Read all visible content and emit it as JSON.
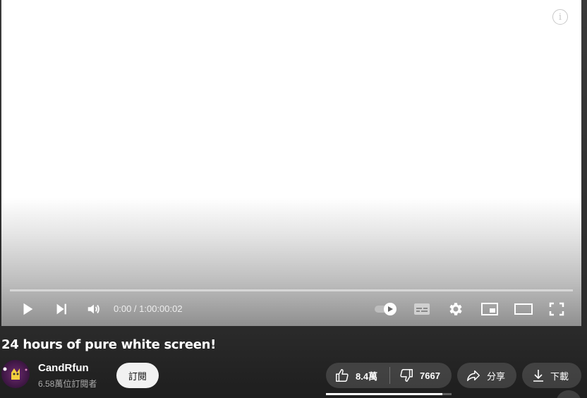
{
  "player": {
    "current_time": "0:00",
    "duration": "1:00:00:02",
    "time_display": "0:00 / 1:00:00:02",
    "progress": 0,
    "info_icon": "i"
  },
  "video": {
    "title": "24 hours of pure white screen!"
  },
  "channel": {
    "name": "CandRfun",
    "subscribers": "6.58萬位訂閱者",
    "subscribe_label": "訂閱"
  },
  "actions": {
    "like_count": "8.4萬",
    "dislike_count": "7667",
    "share_label": "分享",
    "download_label": "下載"
  },
  "icons": {
    "play": "play-icon",
    "next": "next-icon",
    "volume": "volume-icon",
    "autoplay": "autoplay-toggle-icon",
    "subtitles": "subtitles-icon",
    "settings": "gear-icon",
    "miniplayer": "miniplayer-icon",
    "theater": "theater-mode-icon",
    "fullscreen": "fullscreen-icon"
  },
  "colors": {
    "progress": "#ff0000",
    "subscribe_bg": "#f1f1f1",
    "avatar": "#5a2160"
  }
}
